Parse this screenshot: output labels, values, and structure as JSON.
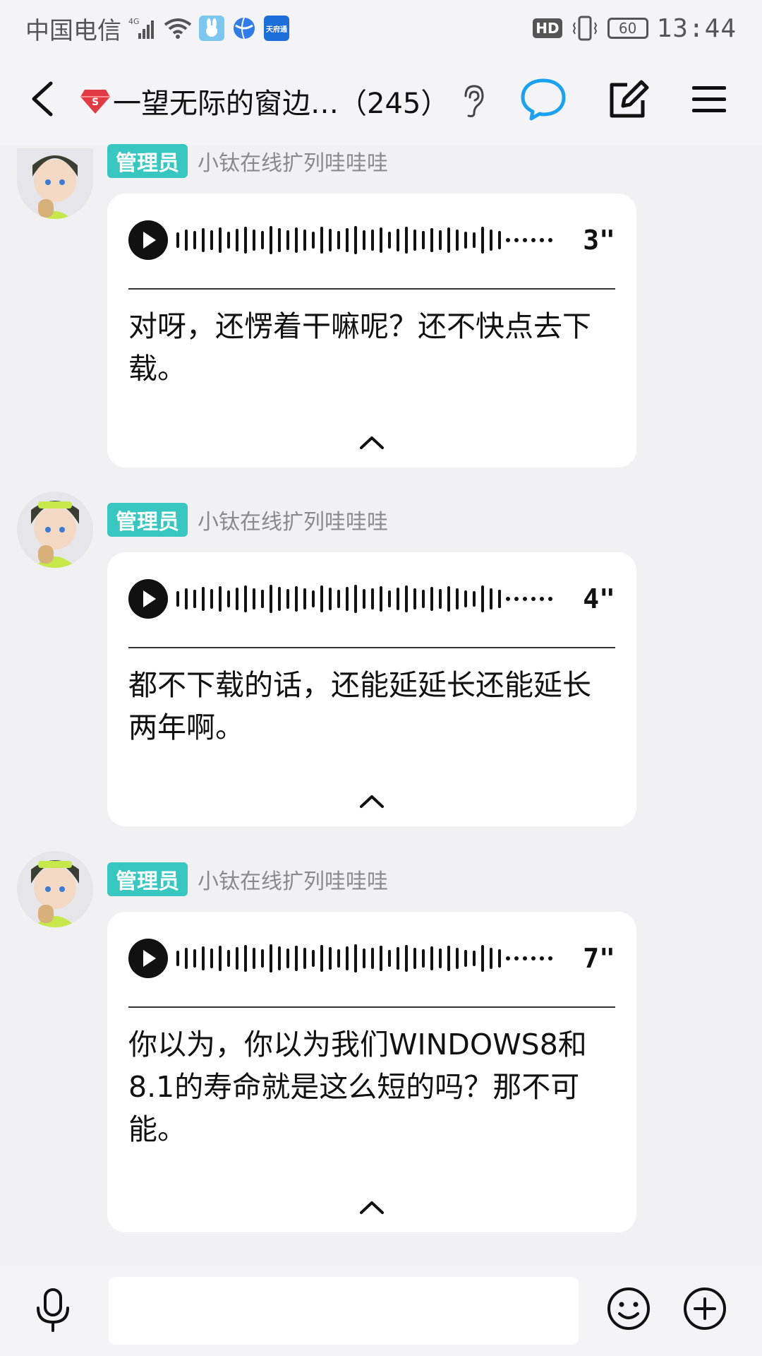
{
  "status_bar": {
    "carrier": "中国电信",
    "network": "4G",
    "app_icon_label": "天府通",
    "hd": "HD",
    "battery": "60",
    "time": "13:44"
  },
  "header": {
    "title": "一望无际的窗边…（245）",
    "icons": [
      "back-icon",
      "diamond-badge-icon",
      "ear-icon",
      "chat-bubble-icon",
      "edit-icon",
      "menu-icon"
    ],
    "active_tab_color": "#1aa1f0"
  },
  "messages": [
    {
      "role": "管理员",
      "sender": "小钛在线扩列哇哇哇",
      "duration": "3\"",
      "transcript": "对呀，还愣着干嘛呢？还不快点去下载。"
    },
    {
      "role": "管理员",
      "sender": "小钛在线扩列哇哇哇",
      "duration": "4\"",
      "transcript": "都不下载的话，还能延延长还能延长两年啊。"
    },
    {
      "role": "管理员",
      "sender": "小钛在线扩列哇哇哇",
      "duration": "7\"",
      "transcript": "你以为，你以为我们WINDOWS8和8.1的寿命就是这么短的吗？那不可能。"
    }
  ],
  "input_bar": {
    "placeholder": "",
    "icons": [
      "mic-icon",
      "emoji-icon",
      "plus-icon"
    ]
  },
  "colors": {
    "badge": "#37c6c0",
    "background": "#f1f1f3",
    "accent": "#1aa1f0"
  }
}
